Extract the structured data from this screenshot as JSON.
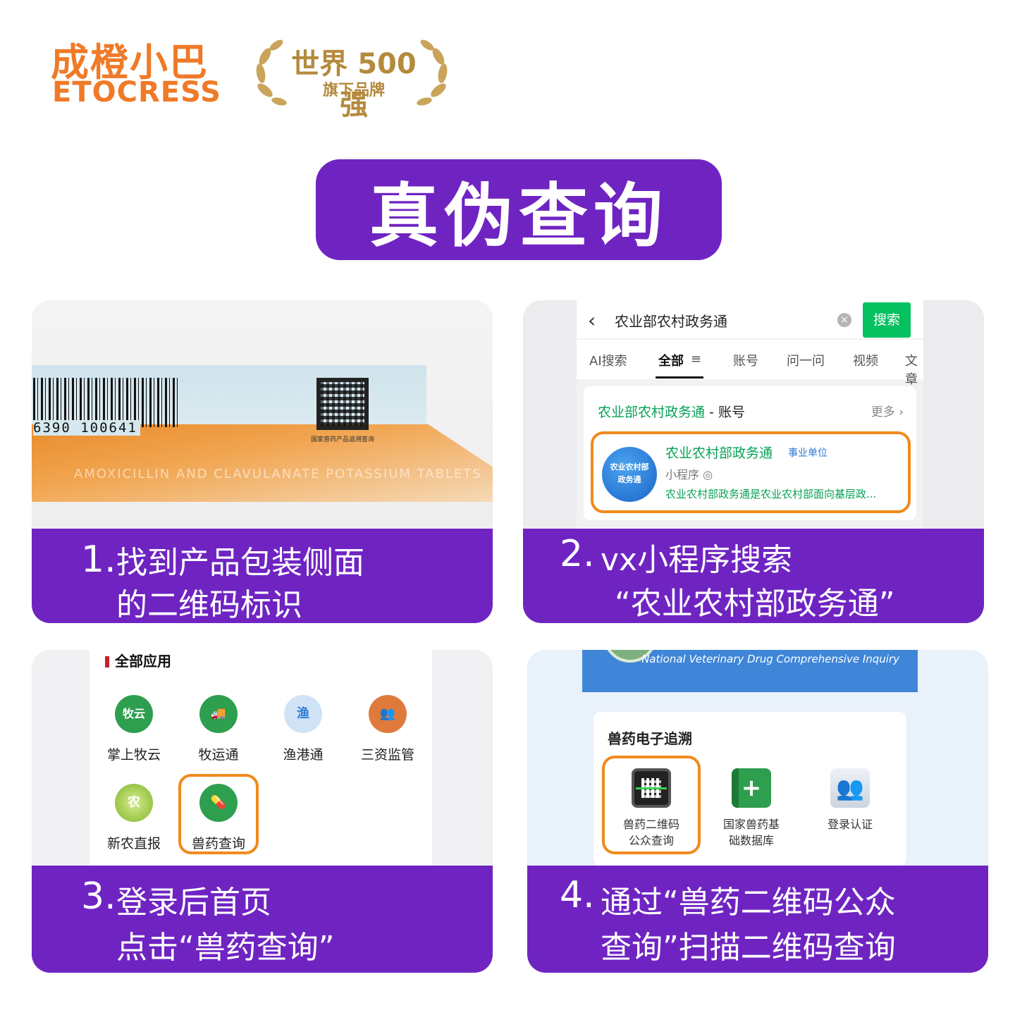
{
  "brand": {
    "name_cn": "成橙小巴",
    "name_en": "ETOCRESS",
    "badge_main": "世界 500 强",
    "badge_sub": "旗下品牌"
  },
  "title": "真伪查询",
  "colors": {
    "purple": "#6f24c2",
    "orange": "#ef7a28",
    "gold": "#b48a3c",
    "highlight": "#f08a1c",
    "wechat_green": "#07c160"
  },
  "steps": [
    {
      "num": "1.",
      "lines": [
        "找到产品包装侧面",
        "的二维码标识"
      ],
      "photo": {
        "barcode_number": "6390 100641",
        "qr_caption": "国家兽药产品追溯查询",
        "box_print": "AMOXICILLIN AND CLAVULANATE POTASSIUM TABLETS"
      }
    },
    {
      "num": "2.",
      "lines": [
        "vx小程序搜索",
        "“农业农村部政务通”"
      ],
      "screen": {
        "search_value": "农业部农村政务通",
        "search_button": "搜索",
        "tabs": [
          "AI搜索",
          "全部",
          "账号",
          "问一问",
          "视频",
          "文章"
        ],
        "result_heading": "农业部农村政务通",
        "result_heading_suffix": " - 账号",
        "more": "更多 ›",
        "item": {
          "avatar_line1": "农业农村部",
          "avatar_line2": "政务通",
          "title": "农业农村部政务通",
          "tag": "事业单位",
          "type": "小程序 ◎",
          "desc": "农业农村部政务通是农业农村部面向基层政..."
        }
      }
    },
    {
      "num": "3.",
      "lines": [
        "登录后首页",
        "点击“兽药查询”"
      ],
      "screen": {
        "heading": "全部应用",
        "apps": [
          {
            "label": "掌上牧云",
            "icon": "muyun-icon",
            "glyph": "牧云",
            "color": "#2e9e4f"
          },
          {
            "label": "牧运通",
            "icon": "truck-icon",
            "glyph": "🚚",
            "color": "#2e9e4f"
          },
          {
            "label": "渔港通",
            "icon": "fishing-port-icon",
            "glyph": "渔",
            "color": "#2f7ad6"
          },
          {
            "label": "三资监管",
            "icon": "people-icon",
            "glyph": "👥",
            "color": "#e07a3c"
          },
          {
            "label": "新农直报",
            "icon": "nong-icon",
            "glyph": "农",
            "color": "#8cc63f"
          },
          {
            "label": "兽药查询",
            "icon": "pill-icon",
            "glyph": "💊",
            "color": "#2e9e4f"
          }
        ]
      }
    },
    {
      "num": "4.",
      "lines": [
        "通过“兽药二维码公众",
        "查询”扫描二维码查询"
      ],
      "screen": {
        "banner": "National Veterinary Drug Comprehensive Inquiry",
        "heading": "兽药电子追溯",
        "tools": [
          {
            "label_1": "兽药二维码",
            "label_2": "公众查询",
            "icon": "qr-scan-icon",
            "color": "#222222"
          },
          {
            "label_1": "国家兽药基",
            "label_2": "础数据库",
            "icon": "database-book-icon",
            "color": "#2e9e4f"
          },
          {
            "label_1": "登录认证",
            "label_2": "",
            "icon": "users-icon",
            "color": "#5b6c8c"
          }
        ]
      }
    }
  ]
}
